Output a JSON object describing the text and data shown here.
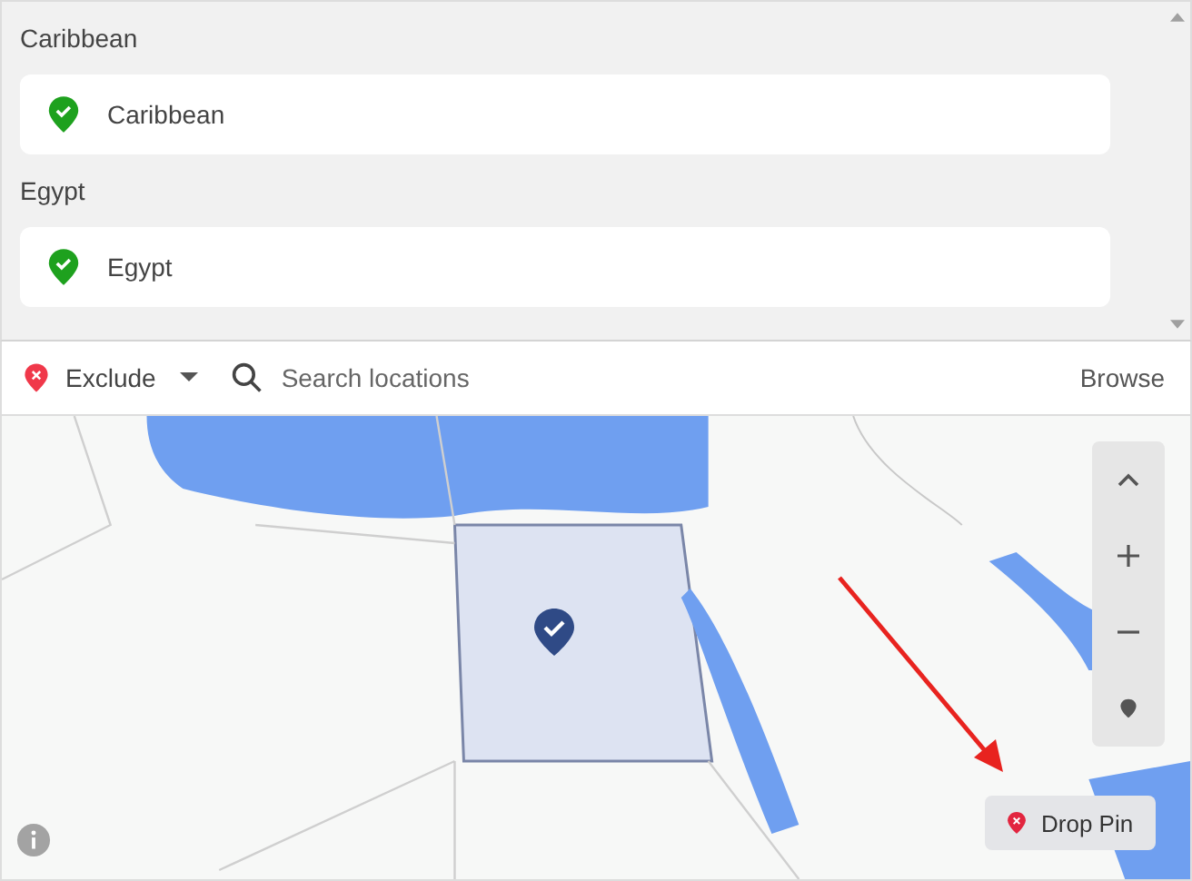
{
  "locations": [
    {
      "heading": "Caribbean",
      "items": [
        {
          "name": "Caribbean",
          "kind": "included"
        }
      ]
    },
    {
      "heading": "Egypt",
      "items": [
        {
          "name": "Egypt",
          "kind": "included"
        }
      ]
    }
  ],
  "toolbar": {
    "mode": {
      "label": "Exclude",
      "kind": "excluded"
    },
    "search": {
      "placeholder": "Search locations"
    },
    "browse": "Browse"
  },
  "map": {
    "kind": "picture",
    "drop_pin": "Drop Pin"
  }
}
